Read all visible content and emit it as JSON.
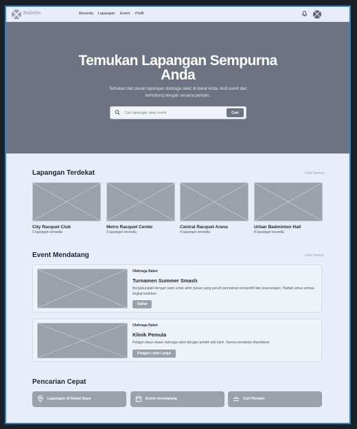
{
  "navbar": {
    "brand": "Raketin",
    "links": [
      "Beranda",
      "Lapangan",
      "Event",
      "Profil"
    ]
  },
  "hero": {
    "title_line1": "Temukan Lapangan Sempurna",
    "title_line2": "Anda",
    "subtitle_line1": "Temukan dan pesan lapangan olahraga raket di dekat Anda. Ikuti event dan",
    "subtitle_line2": "terhubung dengan sesama pemain.",
    "search_placeholder": "Cari lapangan atau event",
    "search_button": "Cari"
  },
  "nearby": {
    "title": "Lapangan Terdekat",
    "see_all": "Lihat Semua",
    "courts": [
      {
        "name": "City Racquet Club",
        "meta": "5 lapangan tersedia"
      },
      {
        "name": "Metro Racquet Center",
        "meta": "3 lapangan tersedia"
      },
      {
        "name": "Central Racquet Arena",
        "meta": "4 lapangan tersedia"
      },
      {
        "name": "Urban Badminton Hall",
        "meta": "8 lapangan tersedia"
      }
    ]
  },
  "events": {
    "title": "Event Mendatang",
    "see_all": "Lihat Semua",
    "items": [
      {
        "category": "Olahraga Raket",
        "name": "Turnamen Summer Smash",
        "desc": "Bergabunglah dengan kami untuk akhir pekan yang penuh permainan kompetitif dan kesenangan. Hadiah untuk semua tingkat keahlian.",
        "button": "Daftar"
      },
      {
        "category": "Olahraga Raket",
        "name": "Klinik Pemula",
        "desc": "Pelajari dasar-dasar olahraga raket dengan pelatih ahli kami. Semua peralatan disediakan.",
        "button": "Pelajari Lebih Lanjut"
      }
    ]
  },
  "quick": {
    "title": "Pencarian Cepat",
    "buttons": [
      {
        "label": "Lapangan di Dekat Saya",
        "icon": "map-pin-icon"
      },
      {
        "label": "Event mendatang",
        "icon": "calendar-icon"
      },
      {
        "label": "Cari Pemain",
        "icon": "users-icon"
      }
    ]
  }
}
